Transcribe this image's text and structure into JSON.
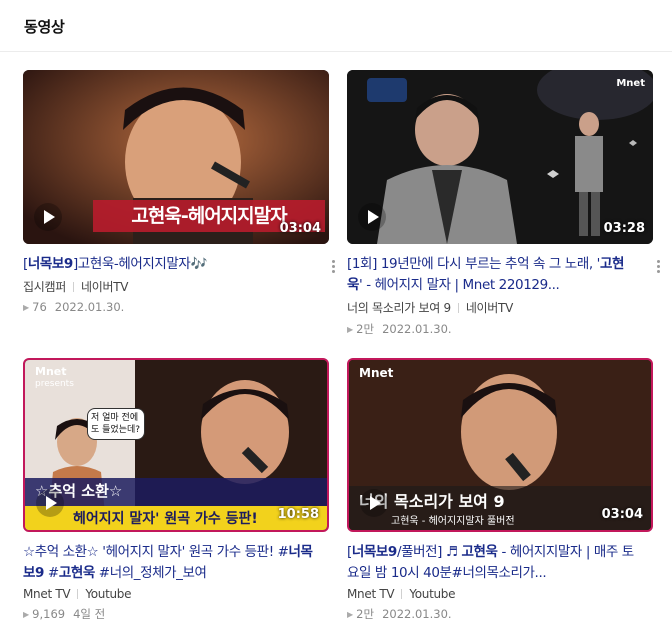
{
  "header": {
    "title": "동영상"
  },
  "videos": [
    {
      "title_pre": "[",
      "title_bold": "너목보9",
      "title_post": "]고현욱-헤어지지말자🎶",
      "duration": "03:04",
      "caption": "고현욱-헤어지지말자",
      "channel": "집시캠퍼",
      "source": "네이버TV",
      "views": "76",
      "date": "2022.01.30."
    },
    {
      "title_pre": "[1회] 19년만에 다시 부르는 추억 속 그 노래, '",
      "title_bold": "고현욱",
      "title_post": "' - 헤어지지 말자 | Mnet 220129...",
      "duration": "03:28",
      "badge": "Mnet",
      "channel": "너의 목소리가 보여 9",
      "source": "네이버TV",
      "views": "2만",
      "date": "2022.01.30."
    },
    {
      "title_pre": "☆추억 소환☆ '헤어지지 말자' 원곡 가수 등판! #",
      "title_bold": "너목보9",
      "title_mid": " #",
      "title_bold2": "고현욱",
      "title_post": " #너의_정체가_보여",
      "duration": "10:58",
      "logo_line1": "Mnet",
      "logo_line2": "presents",
      "bubble": "저 얼마 전에도 들었는데?",
      "caption1": "☆추억 소환☆",
      "caption2": "헤어지지 말자' 원곡 가수 등판!",
      "channel": "Mnet TV",
      "source": "Youtube",
      "views": "9,169",
      "date": "4일 전"
    },
    {
      "title_pre": "[",
      "title_bold": "너목보9",
      "title_mid": "/풀버전] ♬ ",
      "title_bold2": "고현욱",
      "title_post": " - 헤어지지말자 | 매주 토요일 밤 10시 40분#너의목소리가...",
      "duration": "03:04",
      "logo_line1": "Mnet",
      "caption1": "너의 목소리가 보여 9",
      "caption2": "고현욱 - 헤어지지말자 풀버전",
      "channel": "Mnet TV",
      "source": "Youtube",
      "views": "2만",
      "date": "2022.01.30."
    }
  ],
  "colors": {
    "title_link": "#1a2b8a",
    "mnet_pink": "#c2185b"
  },
  "icons": {
    "play": "play-icon",
    "more": "more-vertical-icon",
    "views": "triangle-icon"
  }
}
